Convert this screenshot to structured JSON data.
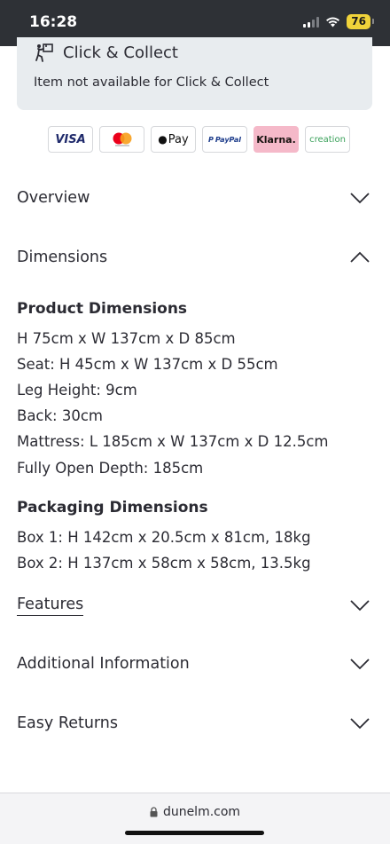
{
  "status_bar": {
    "time": "16:28",
    "battery": "76"
  },
  "click_collect": {
    "title": "Click & Collect",
    "note": "Item not available for Click & Collect"
  },
  "payments": {
    "visa": "VISA",
    "apple_pay": "Pay",
    "paypal": "PayPal",
    "klarna": "Klarna.",
    "creation": "creation"
  },
  "accordion": {
    "overview": "Overview",
    "dimensions": "Dimensions",
    "features": "Features",
    "additional": "Additional Information",
    "returns": "Easy Returns"
  },
  "product_dimensions": {
    "heading": "Product Dimensions",
    "lines": [
      "H 75cm x W 137cm x D 85cm",
      "Seat: H 45cm x W 137cm x D 55cm",
      "Leg Height: 9cm",
      "Back: 30cm",
      "Mattress: L 185cm x W 137cm x D 12.5cm",
      "Fully Open Depth: 185cm"
    ]
  },
  "packaging_dimensions": {
    "heading": "Packaging Dimensions",
    "lines": [
      "Box 1: H 142cm x 20.5cm x 81cm, 18kg",
      "Box 2: H 137cm x 58cm x 58cm, 13.5kg"
    ]
  },
  "browser": {
    "url": "dunelm.com"
  }
}
